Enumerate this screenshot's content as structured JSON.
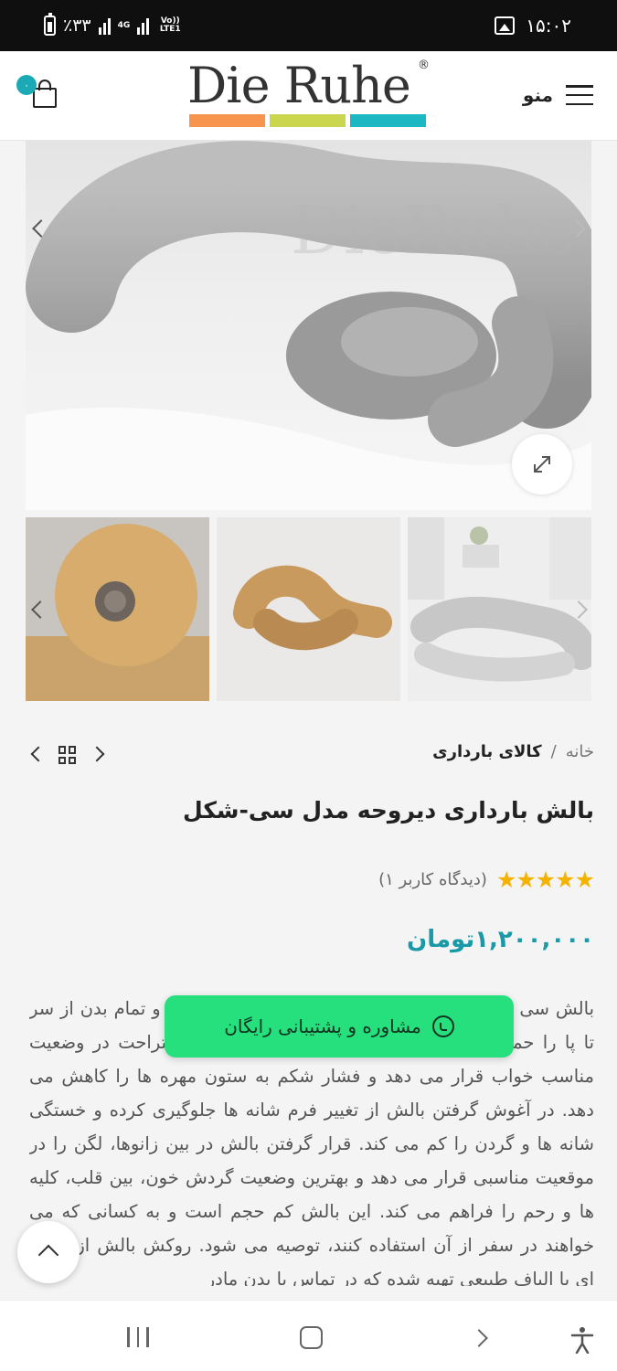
{
  "status_bar": {
    "battery_text": "٪۳۳",
    "network_4g": "4G",
    "network_volte": "Vo)) LTE1",
    "time": "۱۵:۰۲"
  },
  "header": {
    "brand": "Die Ruhe",
    "registered": "®",
    "menu_label": "منو",
    "cart_count": "۰",
    "brand_colors": [
      "#f7944d",
      "#cbd64f",
      "#1bb8c4"
    ]
  },
  "gallery": {
    "watermark": "DieRuhe",
    "main_image": "gray-c-shape-pillow",
    "thumbnails": [
      "beige-pillow-closeup",
      "beige-c-shape-pillow",
      "gray-c-shape-pillow-room"
    ]
  },
  "breadcrumb": {
    "home": "خانه",
    "separator": "/",
    "category": "کالای بارداری"
  },
  "product": {
    "title": "بالش بارداری دیروحه مدل سی-شکل",
    "stars": "★★★★★",
    "rating": 5,
    "review_text": "(دیدگاه کاربر ۱)",
    "price": "۱,۲۰۰,۰۰۰تومان",
    "description": "بالش سی شکل مناسب برای حالت خوابیدن به پهلو است و تمام بدن از سر تا پا را حمایت می کند. این بالش شکم را در حالت استراحت در وضعیت مناسب خواب قرار می دهد و فشار شکم به ستون مهره ها را کاهش می دهد. در آغوش گرفتن بالش از تغییر فرم شانه ها جلوگیری کرده و خستگی شانه ها و گردن را کم می کند. قرار گرفتن بالش در بین زانوها، لگن را در موقعیت مناسبی قرار می دهد و بهترین وضعیت گردش خون، بین قلب، کلیه ها و رحم را فراهم می کند. این بالش کم حجم است و به کسانی که می خواهند در سفر از آن استفاده کنند، توصیه می شود. روکش بالش از پارچه ای با الیاف طبیعی تهیه شده که در تماس با بدن مادر"
  },
  "support": {
    "label": "مشاوره و پشتیبانی رایگان",
    "icon": "whatsapp-icon",
    "color": "#26e07e"
  },
  "accent_color": "#1a9aa6"
}
